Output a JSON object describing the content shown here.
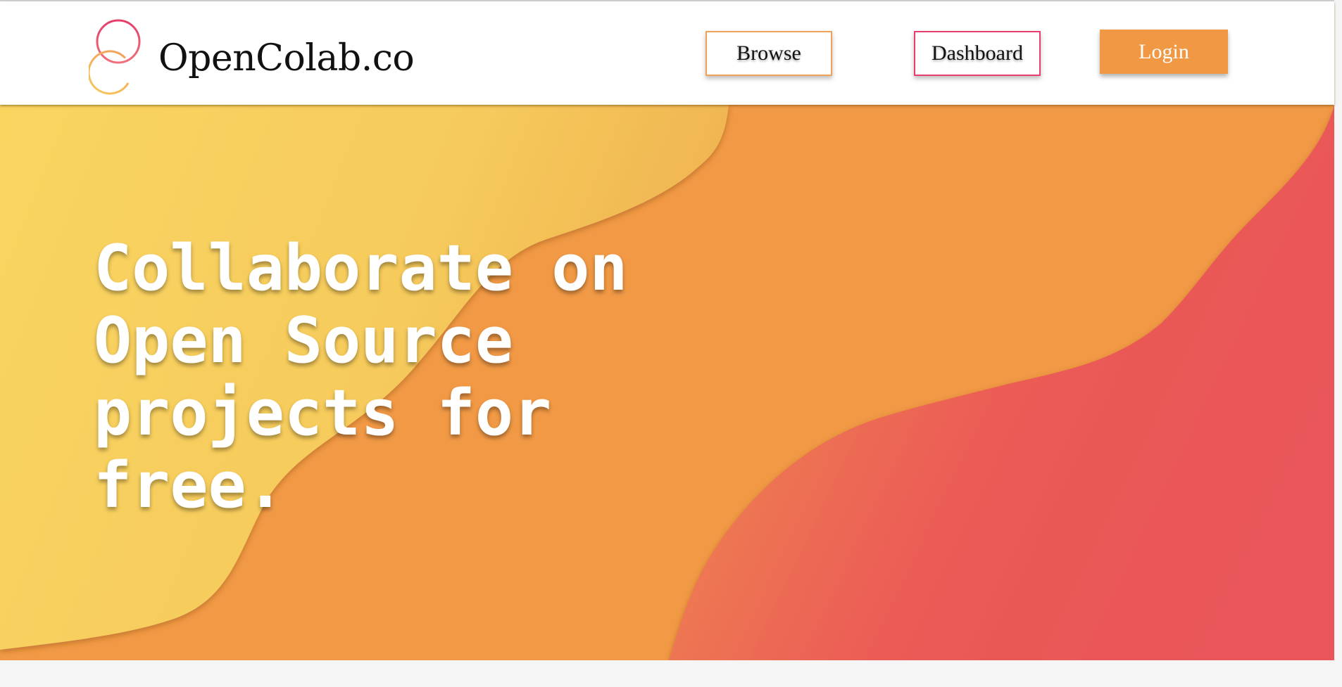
{
  "brand": {
    "name": "OpenColab.co",
    "logo_icon": "interlocking-rings-logo"
  },
  "nav": {
    "browse_label": "Browse",
    "dashboard_label": "Dashboard",
    "login_label": "Login"
  },
  "hero": {
    "headline_lines": [
      "Collaborate on",
      "Open Source",
      "projects for",
      "free."
    ]
  },
  "colors": {
    "accent_orange": "#f19844",
    "accent_pink": "#e63e6d",
    "hero_yellow": "#f9d35f",
    "hero_red": "#ea5858"
  }
}
